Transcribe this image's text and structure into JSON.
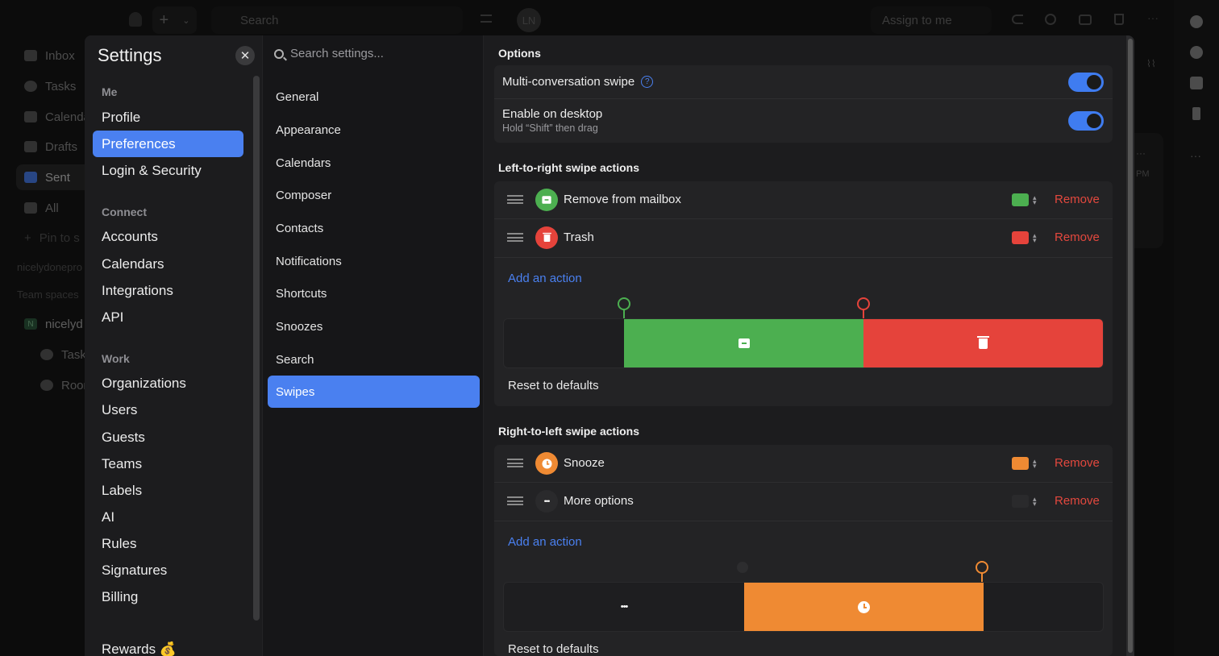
{
  "background_app": {
    "search_placeholder": "Search",
    "avatar_initials": "LN",
    "assign_label": "Assign to me",
    "sidebar": [
      {
        "label": "Inbox"
      },
      {
        "label": "Tasks"
      },
      {
        "label": "Calenda"
      },
      {
        "label": "Drafts"
      },
      {
        "label": "Sent"
      },
      {
        "label": "All"
      }
    ],
    "pin_label": "Pin to s",
    "workspace_label": "nicelydonepro",
    "team_spaces_label": "Team spaces",
    "team_name": "nicelyd",
    "team_initial": "N",
    "team_tasks": "Tasks",
    "team_rooms": "Room",
    "time_fragment": "PM"
  },
  "settings": {
    "title": "Settings",
    "close_symbol": "✕",
    "groups": {
      "me": "Me",
      "connect": "Connect",
      "work": "Work"
    },
    "me_items": [
      "Profile",
      "Preferences",
      "Login & Security"
    ],
    "connect_items": [
      "Accounts",
      "Calendars",
      "Integrations",
      "API"
    ],
    "work_items": [
      "Organizations",
      "Users",
      "Guests",
      "Teams",
      "Labels",
      "AI",
      "Rules",
      "Signatures",
      "Billing"
    ],
    "rewards": "Rewards 💰",
    "selected": "Preferences",
    "search_placeholder": "Search settings...",
    "sub_items": [
      "General",
      "Appearance",
      "Calendars",
      "Composer",
      "Contacts",
      "Notifications",
      "Shortcuts",
      "Snoozes",
      "Search",
      "Swipes"
    ],
    "sub_selected": "Swipes"
  },
  "swipes": {
    "options_title": "Options",
    "multi_swipe_label": "Multi-conversation swipe",
    "multi_swipe_on": true,
    "desktop_label": "Enable on desktop",
    "desktop_hint": "Hold “Shift” then drag",
    "desktop_on": true,
    "ltr_title": "Left-to-right swipe actions",
    "ltr_actions": [
      {
        "name": "Remove from mailbox",
        "color": "#4caf50",
        "remove": "Remove",
        "icon": "archive-icon"
      },
      {
        "name": "Trash",
        "color": "#e5433b",
        "remove": "Remove",
        "icon": "trash-icon"
      }
    ],
    "rtl_title": "Right-to-left swipe actions",
    "rtl_actions": [
      {
        "name": "Snooze",
        "color": "#ef8a33",
        "remove": "Remove",
        "icon": "clock-icon"
      },
      {
        "name": "More options",
        "color": "#232325",
        "remove": "Remove",
        "icon": "ellipsis-icon"
      }
    ],
    "add_action": "Add an action",
    "reset": "Reset to defaults",
    "ellipsis_glyph": "•••"
  }
}
